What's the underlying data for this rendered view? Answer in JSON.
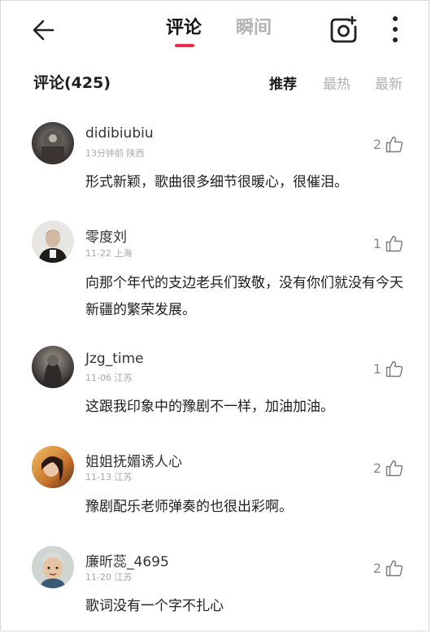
{
  "topbar": {
    "back_icon": "back-arrow-icon",
    "tab_comments": "评论",
    "tab_moments": "瞬间",
    "active_color": "#ef2d50",
    "camera_icon": "camera-icon",
    "more_icon": "more-vertical-icon"
  },
  "header": {
    "title": "评论(425)",
    "sort_recommended": "推荐",
    "sort_hottest": "最热",
    "sort_newest": "最新"
  },
  "comments": [
    {
      "name": "didibiubiu",
      "time": "13分钟前",
      "location": "陕西",
      "likes": "2",
      "text": "形式新颖，歌曲很多细节很暖心，很催泪。"
    },
    {
      "name": "零度刘",
      "time": "11-22",
      "location": "上海",
      "likes": "1",
      "text": "向那个年代的支边老兵们致敬，没有你们就没有今天新疆的繁荣发展。"
    },
    {
      "name": "Jzg_time",
      "time": "11-06",
      "location": "江苏",
      "likes": "1",
      "text": "这跟我印象中的豫剧不一样，加油加油。"
    },
    {
      "name": "姐姐抚媚诱人心",
      "time": "11-13",
      "location": "江苏",
      "likes": "2",
      "text": "豫剧配乐老师弹奏的也很出彩啊。"
    },
    {
      "name": "廉昕蕊_4695",
      "time": "11-20",
      "location": "江苏",
      "likes": "2",
      "text": "歌词没有一个字不扎心"
    }
  ]
}
